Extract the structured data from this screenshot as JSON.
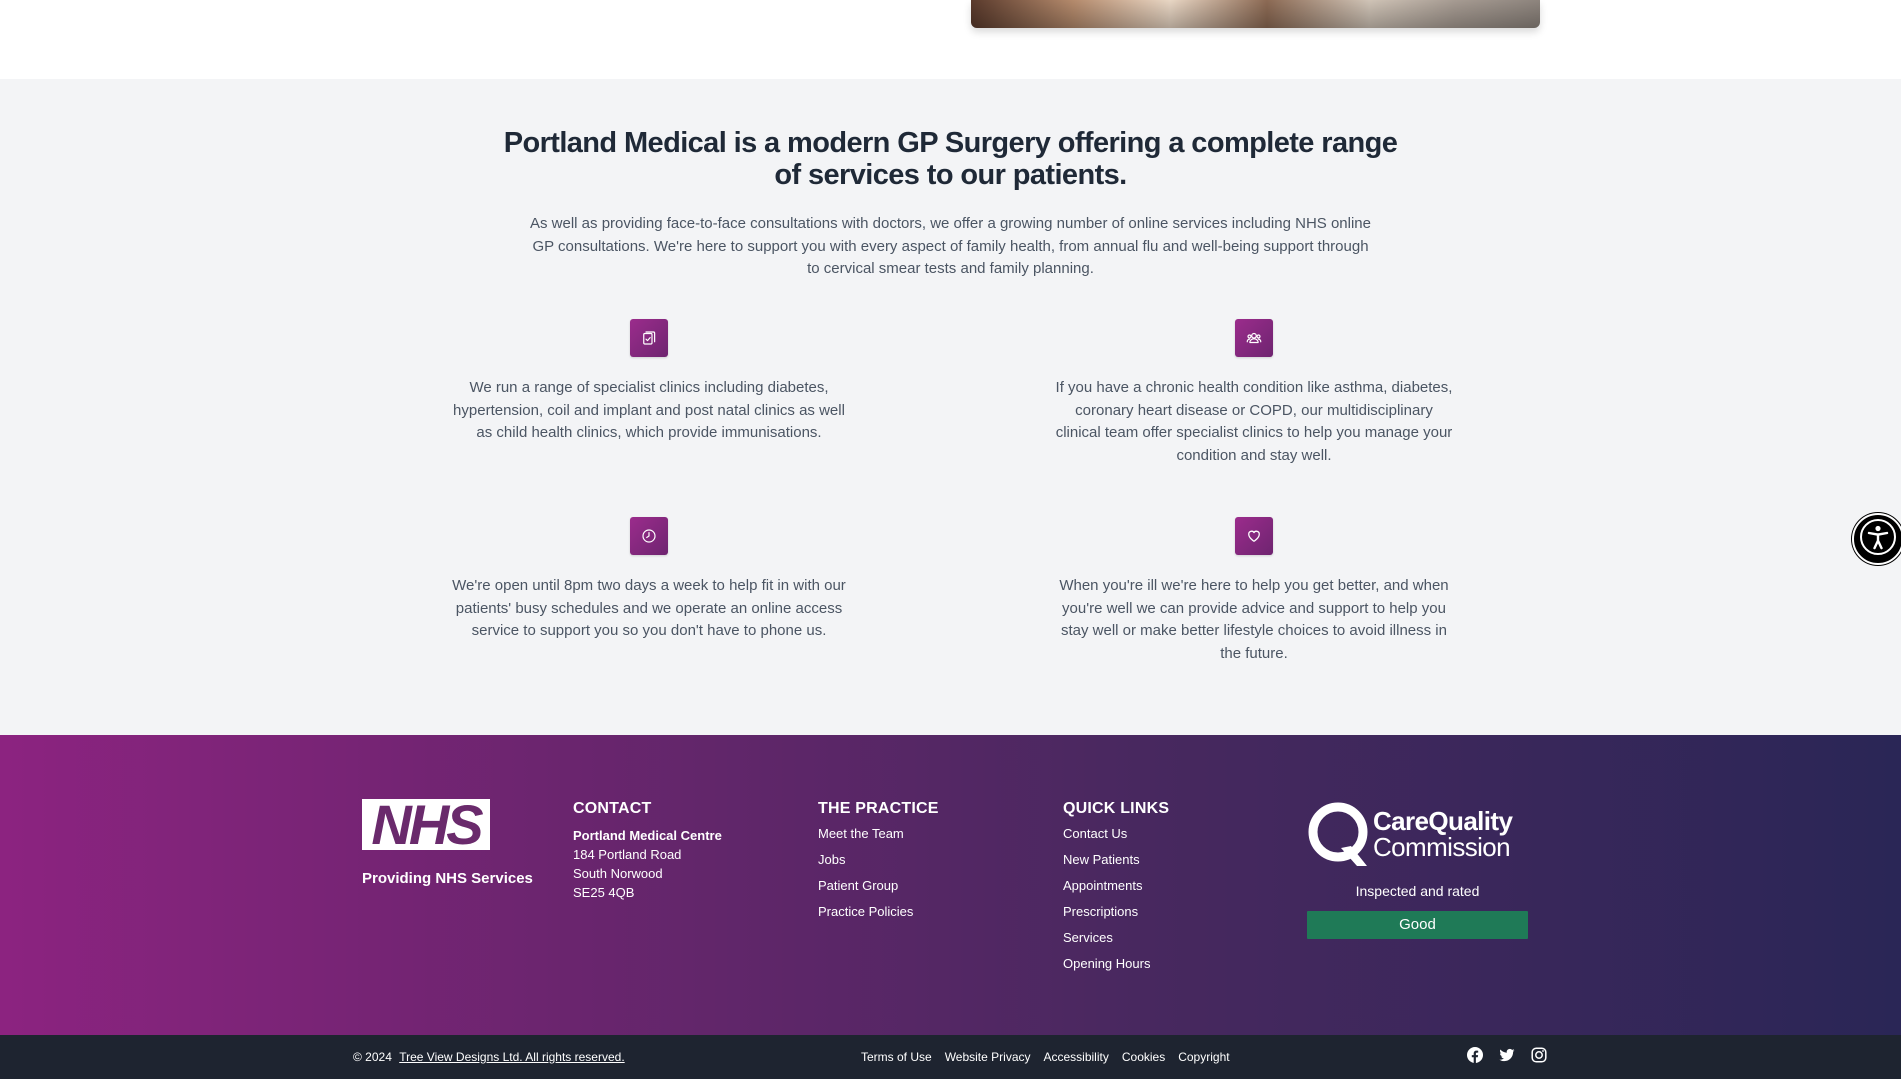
{
  "services": {
    "heading": "Portland Medical is a modern GP Surgery offering a complete range of services to our patients.",
    "intro": "As well as providing face-to-face consultations with doctors, we offer a growing number of online services including NHS online GP consultations. We're here to support you with every aspect of family health, from annual flu and well-being support through to cervical smear tests and family planning.",
    "features": [
      {
        "icon": "clipboard-check-icon",
        "text": "We run a range of specialist clinics including diabetes, hypertension, coil and implant and post natal clinics as well as child health clinics, which provide immunisations."
      },
      {
        "icon": "users-icon",
        "text": "If you have a chronic health condition like asthma, diabetes, coronary heart disease or COPD, our multidisciplinary clinical team offer specialist clinics to help you manage your condition and stay well."
      },
      {
        "icon": "clock-icon",
        "text": "We're open until 8pm two days a week to help fit in with our patients' busy schedules and we operate an online access service to support you so you don't have to phone us."
      },
      {
        "icon": "heart-icon",
        "text": "When you're ill we're here to help you get better, and when you're well we can provide advice and support to help you stay well or make better lifestyle choices to avoid illness in the future."
      }
    ],
    "icon_color": "#8a2a84"
  },
  "footer": {
    "nhs_logo_text": "NHS",
    "nhs_caption": "Providing NHS Services",
    "contact": {
      "heading": "CONTACT",
      "name": "Portland Medical Centre",
      "address1": "184 Portland Road",
      "address2": "South Norwood",
      "postcode": "SE25 4QB"
    },
    "practice": {
      "heading": "THE PRACTICE",
      "links": [
        "Meet the Team",
        "Jobs",
        "Patient Group",
        "Practice Policies"
      ]
    },
    "quick_links": {
      "heading": "QUICK LINKS",
      "links": [
        "Contact Us",
        "New Patients",
        "Appointments",
        "Prescriptions",
        "Services",
        "Opening Hours"
      ]
    },
    "cqc": {
      "logo_line1": "CareQuality",
      "logo_line2": "Commission",
      "caption": "Inspected and rated",
      "rating": "Good",
      "rating_color": "#1f7a57"
    },
    "gradient_colors": [
      "#8c2380",
      "#2a2656"
    ]
  },
  "bottombar": {
    "copyright": "© 2024",
    "company_link": "Tree View Designs Ltd. All rights reserved.",
    "legal_links": [
      "Terms of Use",
      "Website Privacy",
      "Accessibility",
      "Cookies",
      "Copyright"
    ],
    "social_icons": [
      "facebook-icon",
      "twitter-icon",
      "instagram-icon"
    ]
  },
  "accessibility_widget": {
    "icon": "accessibility-icon"
  }
}
